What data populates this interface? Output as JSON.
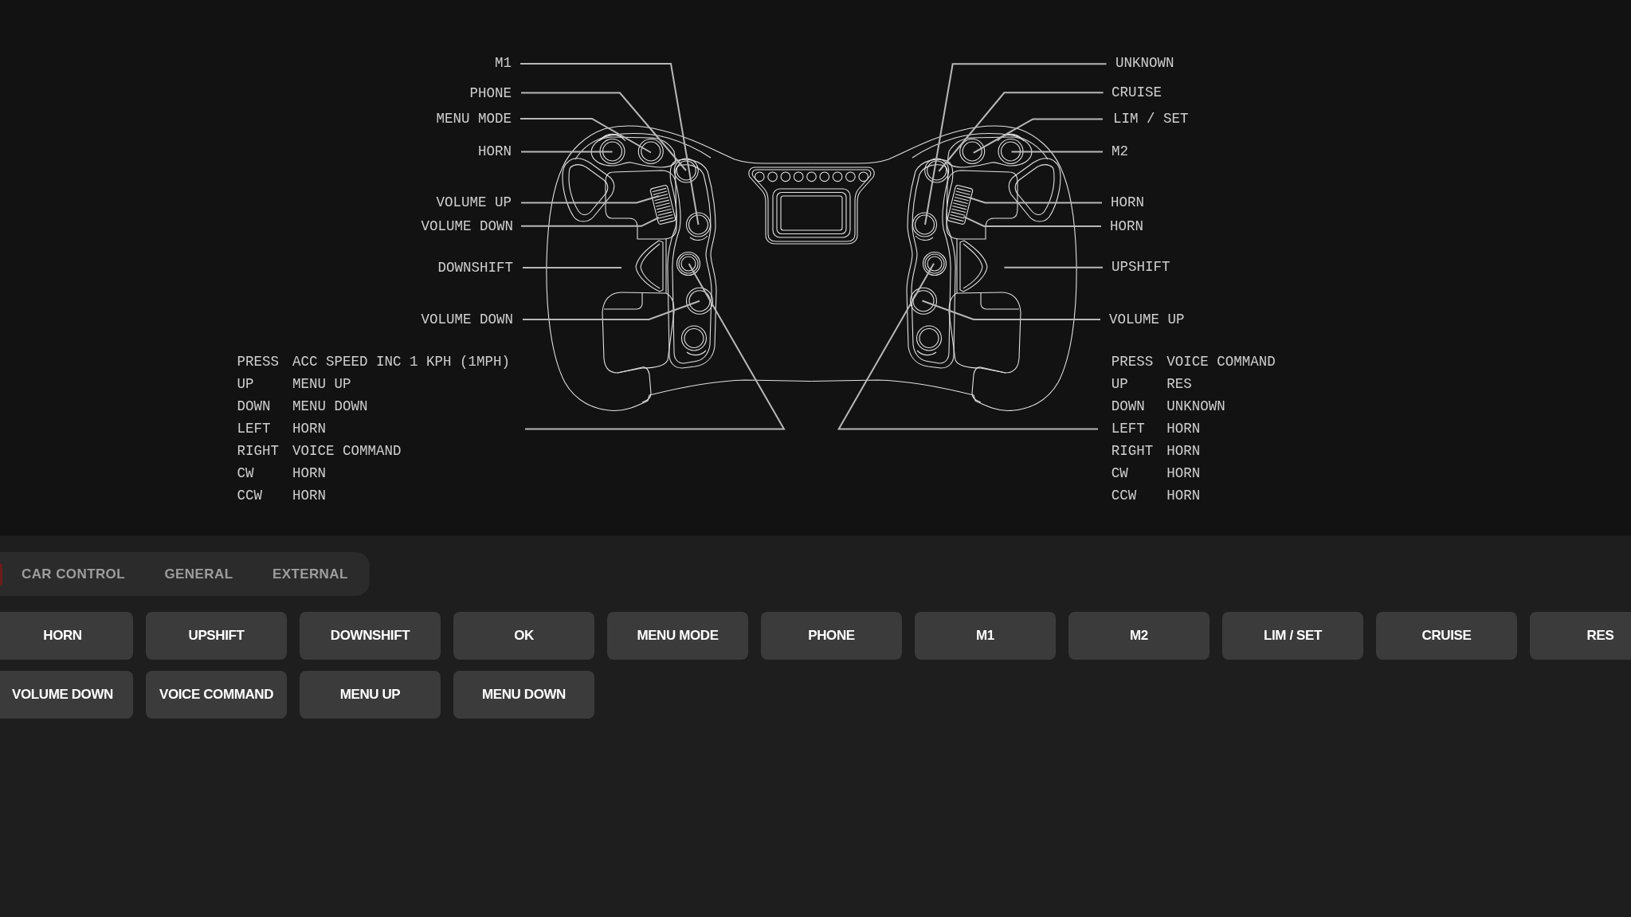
{
  "diagram": {
    "left_callouts": [
      "M1",
      "PHONE",
      "MENU MODE",
      "HORN",
      "VOLUME UP",
      "VOLUME DOWN",
      "DOWNSHIFT",
      "VOLUME DOWN"
    ],
    "right_callouts": [
      "UNKNOWN",
      "CRUISE",
      "LIM / SET",
      "M2",
      "HORN",
      "HORN",
      "UPSHIFT",
      "VOLUME UP"
    ],
    "left_encoder": [
      {
        "input": "PRESS",
        "function": "ACC SPEED INC 1 KPH (1MPH)"
      },
      {
        "input": "UP",
        "function": "MENU UP"
      },
      {
        "input": "DOWN",
        "function": "MENU DOWN"
      },
      {
        "input": "LEFT",
        "function": "HORN"
      },
      {
        "input": "RIGHT",
        "function": "VOICE COMMAND"
      },
      {
        "input": "CW",
        "function": "HORN"
      },
      {
        "input": "CCW",
        "function": "HORN"
      }
    ],
    "right_encoder": [
      {
        "input": "PRESS",
        "function": "VOICE COMMAND"
      },
      {
        "input": "UP",
        "function": "RES"
      },
      {
        "input": "DOWN",
        "function": "UNKNOWN"
      },
      {
        "input": "LEFT",
        "function": "HORN"
      },
      {
        "input": "RIGHT",
        "function": "HORN"
      },
      {
        "input": "CW",
        "function": "HORN"
      },
      {
        "input": "CCW",
        "function": "HORN"
      }
    ]
  },
  "tabs": [
    {
      "label": "CAR CONTROL",
      "selected": false
    },
    {
      "label": "GENERAL",
      "selected": false
    },
    {
      "label": "EXTERNAL",
      "selected": false
    }
  ],
  "button_rows": [
    [
      "HORN",
      "UPSHIFT",
      "DOWNSHIFT",
      "OK",
      "MENU MODE",
      "PHONE",
      "M1",
      "M2",
      "LIM / SET",
      "CRUISE",
      "RES"
    ],
    [
      "VOLUME DOWN",
      "VOICE COMMAND",
      "MENU UP",
      "MENU DOWN"
    ]
  ]
}
